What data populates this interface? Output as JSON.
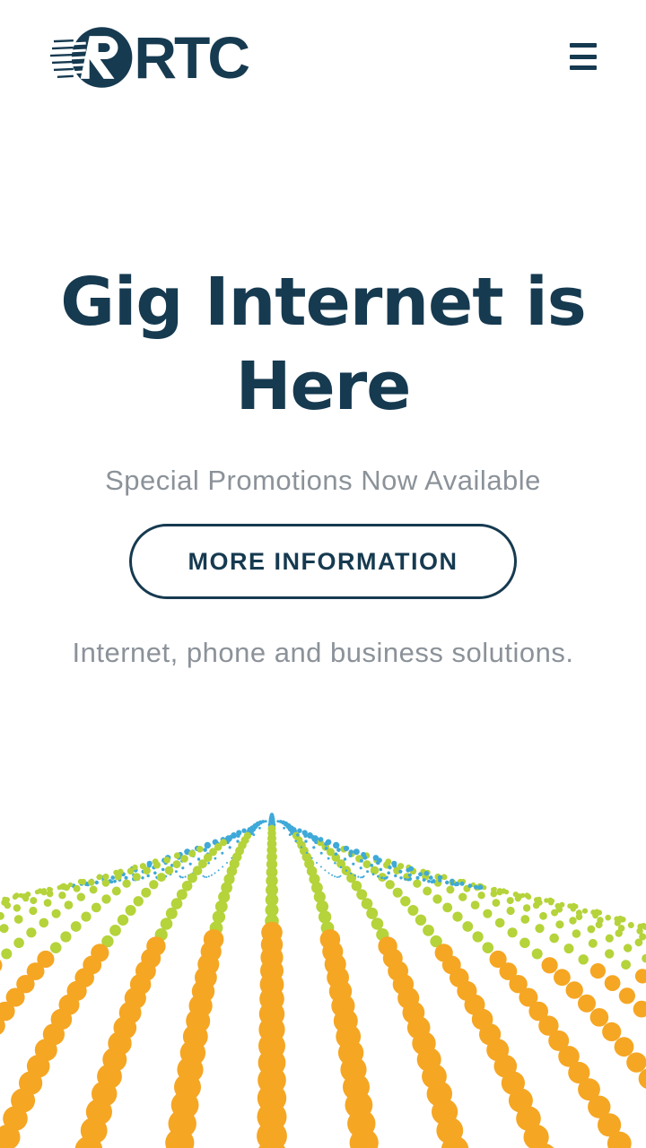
{
  "header": {
    "logo_text": "RTC",
    "menu_icon": "hamburger-icon"
  },
  "hero": {
    "title": "Gig Internet is Here",
    "subtitle": "Special Promotions Now Available",
    "cta_label": "MORE INFORMATION",
    "tagline": "Internet, phone and business solutions."
  },
  "colors": {
    "brand_navy": "#163a50",
    "muted_text": "#8b9299",
    "dot_blue": "#3fa9d8",
    "dot_green": "#b5d33a",
    "dot_orange": "#f5a623"
  }
}
